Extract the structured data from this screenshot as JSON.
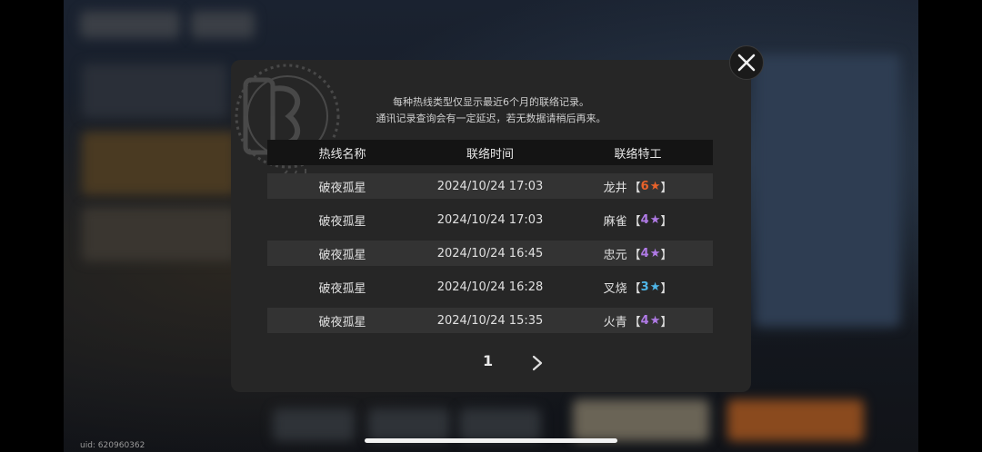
{
  "notice": {
    "line1": "每种热线类型仅显示最近6个月的联络记录。",
    "line2": "通讯记录查询会有一定延迟，若无数据请稍后再来。"
  },
  "table": {
    "headers": [
      "热线名称",
      "联络时间",
      "联络特工"
    ],
    "rows": [
      {
        "hotline": "破夜孤星",
        "time": "2024/10/24 17:03",
        "agent": "龙井",
        "rank": "6",
        "rank_color": "#e8622a"
      },
      {
        "hotline": "破夜孤星",
        "time": "2024/10/24 17:03",
        "agent": "麻雀",
        "rank": "4",
        "rank_color": "#b07ae6"
      },
      {
        "hotline": "破夜孤星",
        "time": "2024/10/24 16:45",
        "agent": "忠元",
        "rank": "4",
        "rank_color": "#b07ae6"
      },
      {
        "hotline": "破夜孤星",
        "time": "2024/10/24 16:28",
        "agent": "叉烧",
        "rank": "3",
        "rank_color": "#4fb6e8"
      },
      {
        "hotline": "破夜孤星",
        "time": "2024/10/24 15:35",
        "agent": "火青",
        "rank": "4",
        "rank_color": "#b07ae6"
      }
    ],
    "rank_open": "【",
    "rank_close": "】",
    "star_glyph": "★"
  },
  "pagination": {
    "current_page": "1"
  },
  "uid": "uid: 620960362",
  "icons": {
    "close": "close-icon",
    "next": "chevron-right-icon",
    "emblem": "phone-emblem-icon"
  }
}
